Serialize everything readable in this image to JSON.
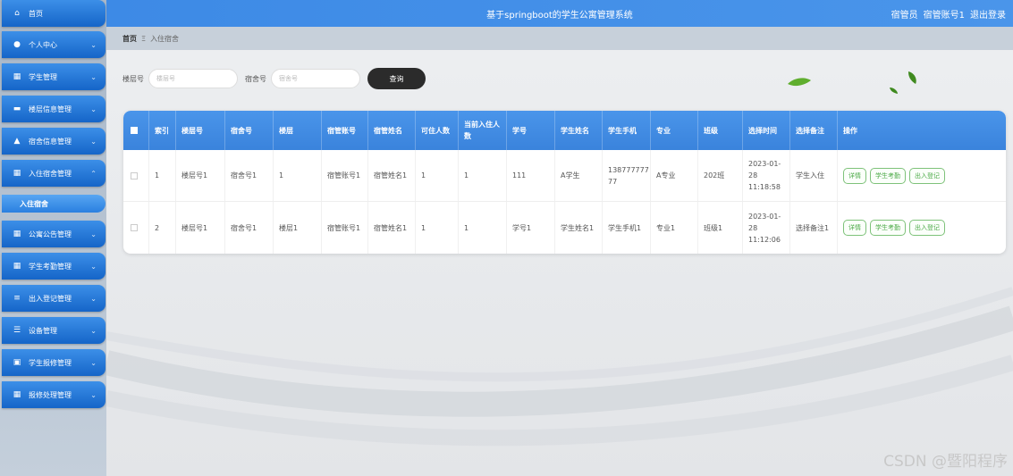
{
  "header": {
    "title": "基于springboot的学生公寓管理系统",
    "user_role": "宿管员",
    "user_name": "宿管账号1",
    "logout": "退出登录"
  },
  "sidebar": {
    "items": [
      {
        "label": "首页",
        "icon": "home-icon"
      },
      {
        "label": "个人中心",
        "icon": "user-icon"
      },
      {
        "label": "学生管理",
        "icon": "grid-icon"
      },
      {
        "label": "楼层信息管理",
        "icon": "message-icon"
      },
      {
        "label": "宿舍信息管理",
        "icon": "building-icon"
      },
      {
        "label": "入住宿舍管理",
        "icon": "grid-icon"
      },
      {
        "label": "公寓公告管理",
        "icon": "grid-icon"
      },
      {
        "label": "学生考勤管理",
        "icon": "grid-icon"
      },
      {
        "label": "出入登记管理",
        "icon": "list-icon"
      },
      {
        "label": "设备管理",
        "icon": "sliders-icon"
      },
      {
        "label": "学生报修管理",
        "icon": "clipboard-icon"
      },
      {
        "label": "报修处理管理",
        "icon": "grid-icon"
      }
    ],
    "sub_item": "入住宿舍"
  },
  "breadcrumb": {
    "home": "首页",
    "sep": "Ξ",
    "current": "入住宿舍"
  },
  "search": {
    "floor_label": "楼层号",
    "floor_placeholder": "楼层号",
    "room_label": "宿舍号",
    "room_placeholder": "宿舍号",
    "button": "查询"
  },
  "table": {
    "columns": [
      "索引",
      "楼层号",
      "宿舍号",
      "楼层",
      "宿管账号",
      "宿管姓名",
      "可住人数",
      "当前入住人数",
      "学号",
      "学生姓名",
      "学生手机",
      "专业",
      "班级",
      "选择时间",
      "选择备注",
      "操作"
    ],
    "rows": [
      [
        "1",
        "楼层号1",
        "宿舍号1",
        "1",
        "宿管账号1",
        "宿管姓名1",
        "1",
        "1",
        "111",
        "A学生",
        "13877777777",
        "A专业",
        "202班",
        "2023-01-28 11:18:58",
        "学生入住"
      ],
      [
        "2",
        "楼层号1",
        "宿舍号1",
        "楼层1",
        "宿管账号1",
        "宿管姓名1",
        "1",
        "1",
        "学号1",
        "学生姓名1",
        "学生手机1",
        "专业1",
        "班级1",
        "2023-01-28 11:12:06",
        "选择备注1"
      ]
    ],
    "actions": [
      "详情",
      "学生考勤",
      "出入登记"
    ]
  },
  "watermark": "CSDN @暨阳程序",
  "colors": {
    "primary": "#3d8ae6",
    "sidebar_item": "#1e6fd0",
    "action_green": "#4caa48"
  }
}
